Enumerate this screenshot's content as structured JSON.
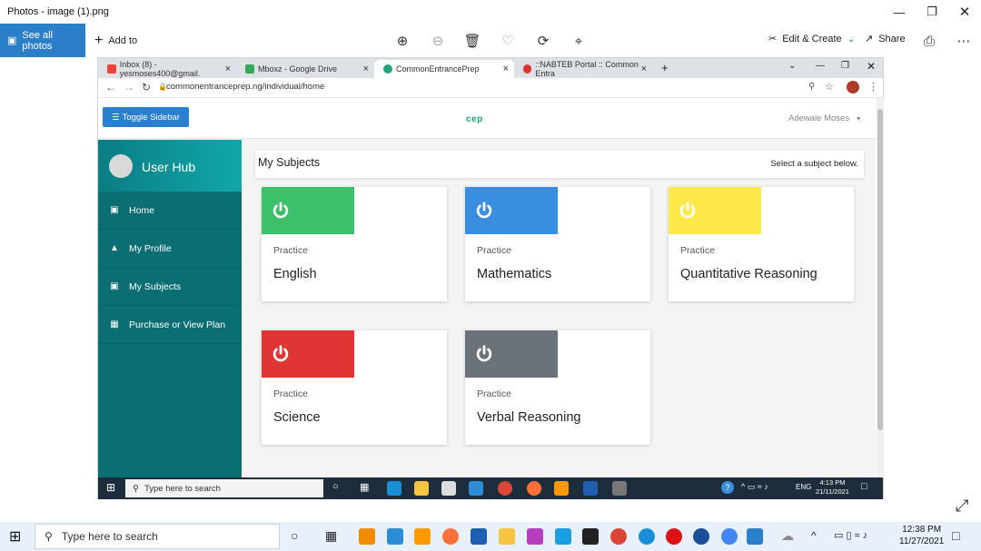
{
  "photos": {
    "title": "Photos - image (1).png",
    "see_all": "See all photos",
    "add_to": "Add to",
    "edit_create": "Edit & Create",
    "share": "Share"
  },
  "browser": {
    "tabs": [
      {
        "label": "Inbox (8) - yesmoses400@gmail.",
        "icon": "gmail-icon"
      },
      {
        "label": "Mboxz - Google Drive",
        "icon": "drive-icon"
      },
      {
        "label": "CommonEntrancePrep",
        "icon": "cep-icon"
      },
      {
        "label": "::NABTEB Portal :: Common Entra",
        "icon": "nabteb-icon"
      }
    ],
    "url": "commonentranceprep.ng/individual/home"
  },
  "page": {
    "toggle_label": "Toggle Sidebar",
    "logo": "cep",
    "user_name": "Adewale Moses",
    "sidebar_title": "User Hub",
    "sidebar_items": [
      "Home",
      "My Profile",
      "My Subjects",
      "Purchase or View Plan"
    ],
    "header_title": "My Subjects",
    "header_sub": "Select a subject below.",
    "practice_label": "Practice",
    "subjects": [
      {
        "name": "English",
        "color": "#3cc06a"
      },
      {
        "name": "Mathematics",
        "color": "#3a8ee0"
      },
      {
        "name": "Quantitative Reasoning",
        "color": "#ffe94a"
      },
      {
        "name": "Science",
        "color": "#e03535"
      },
      {
        "name": "Verbal Reasoning",
        "color": "#6c727a"
      }
    ]
  },
  "inner_taskbar": {
    "search_placeholder": "Type here to search",
    "lang": "ENG",
    "time": "4:13 PM",
    "date": "21/11/2021"
  },
  "taskbar": {
    "search_placeholder": "Type here to search",
    "time": "12:38 PM",
    "date": "11/27/2021"
  }
}
